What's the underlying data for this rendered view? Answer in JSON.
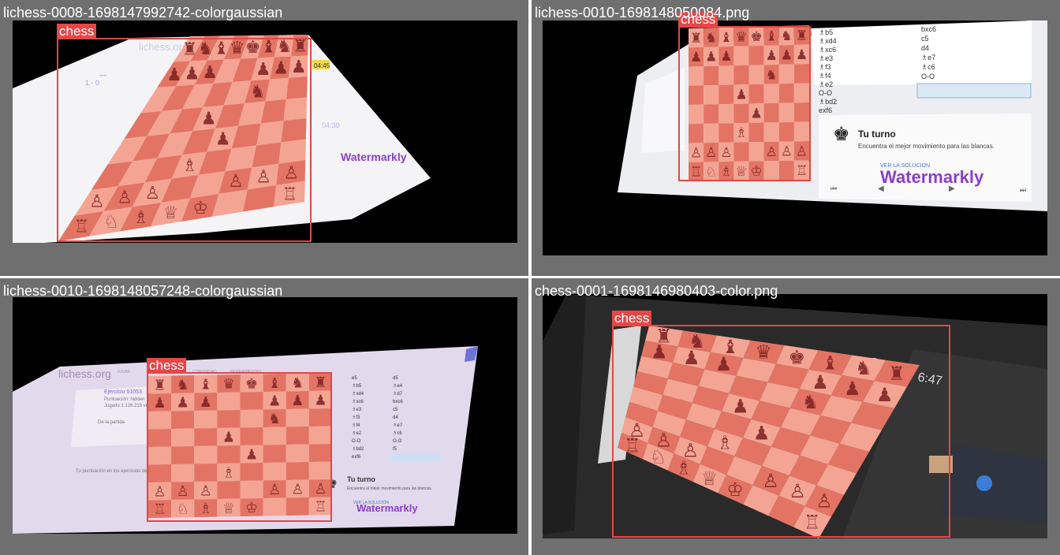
{
  "colors": {
    "tile_bg": "#6f6f6f",
    "box": "#e64646",
    "board_light": "#f4a493",
    "board_dark": "#e37464",
    "wm": "#8a3fd0"
  },
  "panels": [
    {
      "title": "lichess-0008-1698147992742-colorgaussian",
      "detection_label": "chess",
      "text": {
        "brand": "lichess.org",
        "timer_a": "04:45",
        "timer_b": "04:30",
        "score": "1 - 0",
        "watermark": "Watermarkly"
      }
    },
    {
      "title": "lichess-0010-1698148050084.png",
      "detection_label": "chess",
      "text": {
        "moves_white": [
          "♗b5",
          "♗xd4",
          "♗xc6",
          "♗e3",
          "♗f3",
          "♗f4",
          "♗e2",
          "O-O",
          "♗bd2",
          "exf6"
        ],
        "moves_black": [
          "bxc6",
          "c5",
          "d4",
          "♗e7",
          "♗c6",
          "O-O",
          "f5",
          "♗xf6"
        ],
        "your_turn": "Tu turno",
        "your_turn_desc": "Encuentra el mejor movimiento para las blancas.",
        "see_solution": "VER LA SOLUCIÓN",
        "watermark": "Watermarkly"
      }
    },
    {
      "title": "lichess-0010-1698148057248-colorgaussian",
      "detection_label": "chess",
      "text": {
        "brand": "lichess.org",
        "nav": [
          "JUGAR",
          "APRENDER",
          "COMUNIDAD",
          "HERRAMIENTAS"
        ],
        "puzzle": "Ejercicio 61053",
        "rating": "Puntuación: hidden",
        "played": "Jugado 1.126.215 veces",
        "from_game": "De la partida",
        "score_text": "Tu puntuación en los ejercicios de táctica: 1500",
        "moves_white": [
          "e5",
          "♗b5",
          "♗xd4",
          "♗xc6",
          "♗e3",
          "♗f3",
          "♗f4",
          "♗e2",
          "O-O",
          "♗bd2",
          "exf6"
        ],
        "moves_black": [
          "d5",
          "♗e4",
          "♗d7",
          "bxc6",
          "c5",
          "d4",
          "♗e7",
          "♗c6",
          "O-O",
          "f5",
          "♗xf6"
        ],
        "your_turn": "Tu turno",
        "your_turn_desc": "Encuentra el mejor movimiento para las blancas.",
        "see_solution": "VER LA SOLUCIÓN",
        "watermark": "Watermarkly"
      }
    },
    {
      "title": "chess-0001-1698146980403-color.png",
      "detection_label": "chess",
      "text": {
        "clock": "6:47"
      }
    }
  ]
}
